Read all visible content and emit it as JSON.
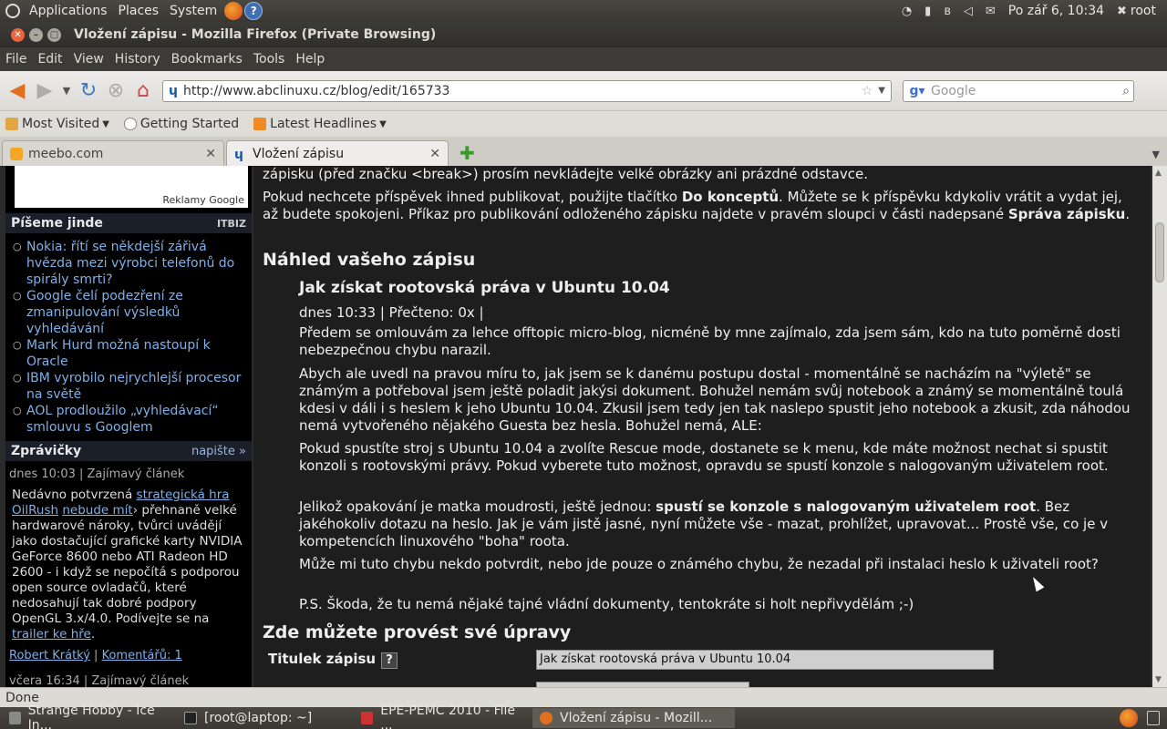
{
  "panel": {
    "menus": [
      "Applications",
      "Places",
      "System"
    ],
    "datetime": "Po zář  6, 10:34",
    "user": "root"
  },
  "window": {
    "title": "Vložení zápisu - Mozilla Firefox (Private Browsing)"
  },
  "menubar": [
    "File",
    "Edit",
    "View",
    "History",
    "Bookmarks",
    "Tools",
    "Help"
  ],
  "nav": {
    "url": "http://www.abclinuxu.cz/blog/edit/165733",
    "search_placeholder": "Google"
  },
  "bookmarks": [
    "Most Visited",
    "Getting Started",
    "Latest Headlines"
  ],
  "tabs": [
    {
      "label": "meebo.com"
    },
    {
      "label": "Vložení zápisu"
    }
  ],
  "sidebar": {
    "ad_label": "Reklamy Google",
    "writing_elsewhere": {
      "title": "Píšeme jinde",
      "badge": "ITBIZ",
      "items": [
        "Nokia: řítí se někdejší zářivá hvězda mezi výrobci telefonů do spirály smrti?",
        "Google čelí podezření ze zmanipulování výsledků vyhledávání",
        "Mark Hurd možná nastoupí k Oracle",
        "IBM vyrobilo nejrychlejší procesor na světě",
        "AOL prodloužilo „vyhledávací“ smlouvu s Googlem"
      ]
    },
    "news": {
      "title": "Zprávičky",
      "action": "napište »",
      "meta": "dnes 10:03 | Zajímavý článek",
      "body_prefix": "Nedávno potvrzená ",
      "link1": "strategická hra OilRush",
      "link2": "nebude mít",
      "body_middle": "› přehnaně velké hardwarové nároky, tvůrci uvádějí jako dostačující grafické karty NVIDIA GeForce 8600 nebo ATI Radeon HD 2600 - i když se nepočítá s podporou open source ovladačů, které nedosahují tak dobré podpory OpenGL 3.x/4.0. Podívejte se na ",
      "link3": "trailer ke hře",
      "body_suffix": ".",
      "author": "Robert Krátký",
      "comments": "Komentářů: 1",
      "next_meta": "včera 16:34 | Zajímavý článek"
    }
  },
  "main": {
    "intro1": "zápisku (před značku <break>) prosím nevkládejte velké obrázky ani prázdné odstavce.",
    "intro2_a": "Pokud nechcete příspěvek ihned publikovat, použijte tlačítko ",
    "intro2_b": "Do konceptů",
    "intro2_c": ". Můžete se k příspěvku kdykoliv vrátit a vydat jej, až budete spokojeni. Příkaz pro publikování odloženého zápisku najdete v pravém sloupci v části nadepsané ",
    "intro2_d": "Správa zápisku",
    "intro2_e": ".",
    "preview_heading": "Náhled vašeho zápisu",
    "post_title": "Jak získat rootovská práva v Ubuntu 10.04",
    "post_meta": "dnes 10:33 | Přečteno: 0x |",
    "para1": "Předem se omlouvám za lehce offtopic micro-blog, nicméně by mne zajímalo, zda jsem sám, kdo na tuto poměrně dosti nebezpečnou chybu narazil.",
    "para2": "Abych ale uvedl na pravou míru to, jak jsem se k danému postupu dostal - momentálně se nacházím na \"výletě\" se známým a potřeboval jsem ještě poladit jakýsi dokument. Bohužel nemám svůj notebook a známý se momentálně toulá kdesi v dáli i s heslem k jeho Ubuntu 10.04. Zkusil jsem tedy jen tak naslepo spustit jeho notebook a zkusit, zda náhodou nemá vytvořeného nějakého Guesta bez hesla. Bohužel nemá, ALE:",
    "para3": "Pokud spustíte stroj s Ubuntu 10.04 a zvolíte Rescue mode, dostanete se k menu, kde máte možnost nechat si spustit konzoli s rootovskými právy. Pokud vyberete tuto možnost, opravdu se spustí konzole s nalogovaným uživatelem root.",
    "para4_a": "Jelikož opakování je matka moudrosti, ještě jednou: ",
    "para4_b": "spustí se konzole s nalogovaným uživatelem root",
    "para4_c": ". Bez jakéhokoliv dotazu na heslo. Jak je vám jistě jasné, nyní můžete vše - mazat, prohlížet, upravovat... Prostě vše, co je v kompetencích linuxového \"boha\" roota.",
    "para5": "Může mi tuto chybu nekdo potvrdit, nebo jde pouze o známého chybu, že nezadal při instalaci heslo k uživateli root?",
    "para6": "P.S. Škoda, že tu nemá nějaké tajné vládní dokumenty, tentokráte si holt nepřivydělám ;-)",
    "edit_heading": "Zde můžete provést své úpravy",
    "title_label": "Titulek zápisu",
    "help_mark": "?",
    "title_value": "Jak získat rootovská práva v Ubuntu 10.04"
  },
  "status": "Done",
  "taskbar": [
    {
      "label": "Strange Hobby - Ice In...",
      "active": false
    },
    {
      "label": "[root@laptop: ~]",
      "active": false
    },
    {
      "label": "EPE-PEMC 2010 - File ...",
      "active": false
    },
    {
      "label": "Vložení zápisu - Mozill...",
      "active": true
    }
  ]
}
